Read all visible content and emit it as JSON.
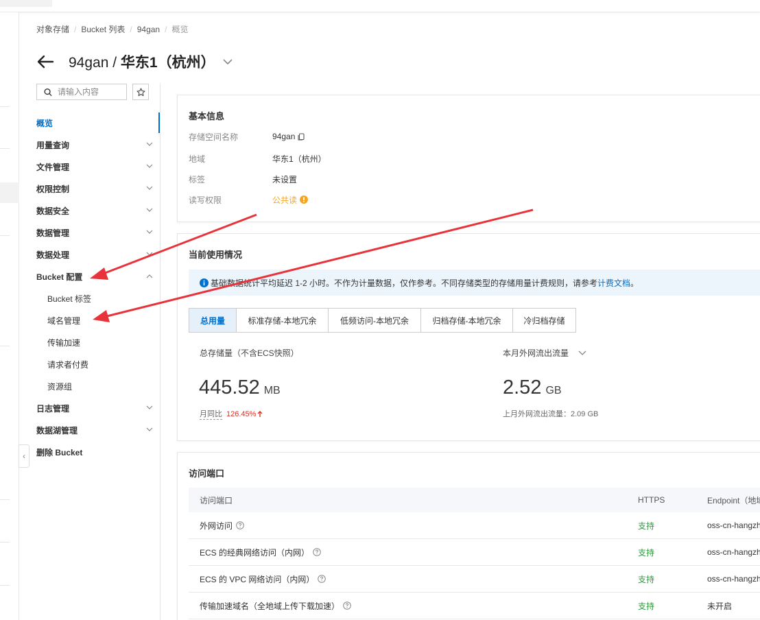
{
  "breadcrumb": [
    "对象存储",
    "Bucket 列表",
    "94gan",
    "概览"
  ],
  "title": {
    "bucket": "94gan",
    "separator": " / ",
    "region": "华东1（杭州）"
  },
  "nav": {
    "search_placeholder": "请输入内容",
    "items": [
      {
        "label": "概览",
        "active": true,
        "expandable": false
      },
      {
        "label": "用量查询",
        "expandable": true
      },
      {
        "label": "文件管理",
        "expandable": true
      },
      {
        "label": "权限控制",
        "expandable": true
      },
      {
        "label": "数据安全",
        "expandable": true
      },
      {
        "label": "数据管理",
        "expandable": true
      },
      {
        "label": "数据处理",
        "expandable": true
      },
      {
        "label": "Bucket 配置",
        "expandable": true,
        "expanded": true
      },
      {
        "label": "日志管理",
        "expandable": true
      },
      {
        "label": "数据湖管理",
        "expandable": true
      },
      {
        "label": "删除 Bucket",
        "expandable": false
      }
    ],
    "bucket_config_children": [
      "Bucket 标签",
      "域名管理",
      "传输加速",
      "请求者付费",
      "资源组"
    ]
  },
  "basic_info": {
    "title": "基本信息",
    "rows": [
      {
        "key": "存储空间名称",
        "value": "94gan"
      },
      {
        "key": "地域",
        "value": "华东1（杭州）"
      },
      {
        "key": "标签",
        "value": "未设置"
      },
      {
        "key": "读写权限",
        "value": "公共读"
      }
    ]
  },
  "usage": {
    "title": "当前使用情况",
    "notice_text": "基础数据统计平均延迟 1-2 小时。不作为计量数据，仅作参考。不同存储类型的存储用量计费规则，请参考",
    "notice_link": "计费文档",
    "notice_end": "。",
    "tabs": [
      "总用量",
      "标准存储-本地冗余",
      "低频访问-本地冗余",
      "归档存储-本地冗余",
      "冷归档存储"
    ],
    "active_tab": 0,
    "storage_label": "总存储量（不含ECS快照）",
    "storage_value": "445.52",
    "storage_unit": "MB",
    "mom_label": "月同比",
    "mom_value": "126.45%",
    "traffic_label": "本月外网流出流量",
    "traffic_value": "2.52",
    "traffic_unit": "GB",
    "last_month_label": "上月外网流出流量：2.09 GB"
  },
  "endpoints": {
    "title": "访问端口",
    "headers": [
      "访问端口",
      "HTTPS",
      "Endpoint（地域节点）"
    ],
    "rows": [
      {
        "name": "外网访问",
        "https": "支持",
        "endpoint": "oss-cn-hangzhou.aliyuncs.com"
      },
      {
        "name": "ECS 的经典网络访问（内网）",
        "https": "支持",
        "endpoint": "oss-cn-hangzhou-internal.aliyuncs.com"
      },
      {
        "name": "ECS 的 VPC 网络访问（内网）",
        "https": "支持",
        "endpoint": "oss-cn-hangzhou-internal.aliyuncs.com"
      },
      {
        "name": "传输加速域名（全地域上传下载加速）",
        "https": "支持",
        "endpoint": "未开启"
      }
    ]
  },
  "colors": {
    "accent": "#0070cc",
    "warn": "#f5a623",
    "success": "#2d9c3c",
    "danger": "#d93026",
    "annotation_arrow": "#e8333b"
  },
  "icons": [
    "back-arrow-icon",
    "chevron-down-icon",
    "search-icon",
    "star-icon",
    "copy-icon",
    "warning-icon",
    "info-icon",
    "help-icon",
    "arrow-up-icon",
    "collapse-left-icon"
  ]
}
